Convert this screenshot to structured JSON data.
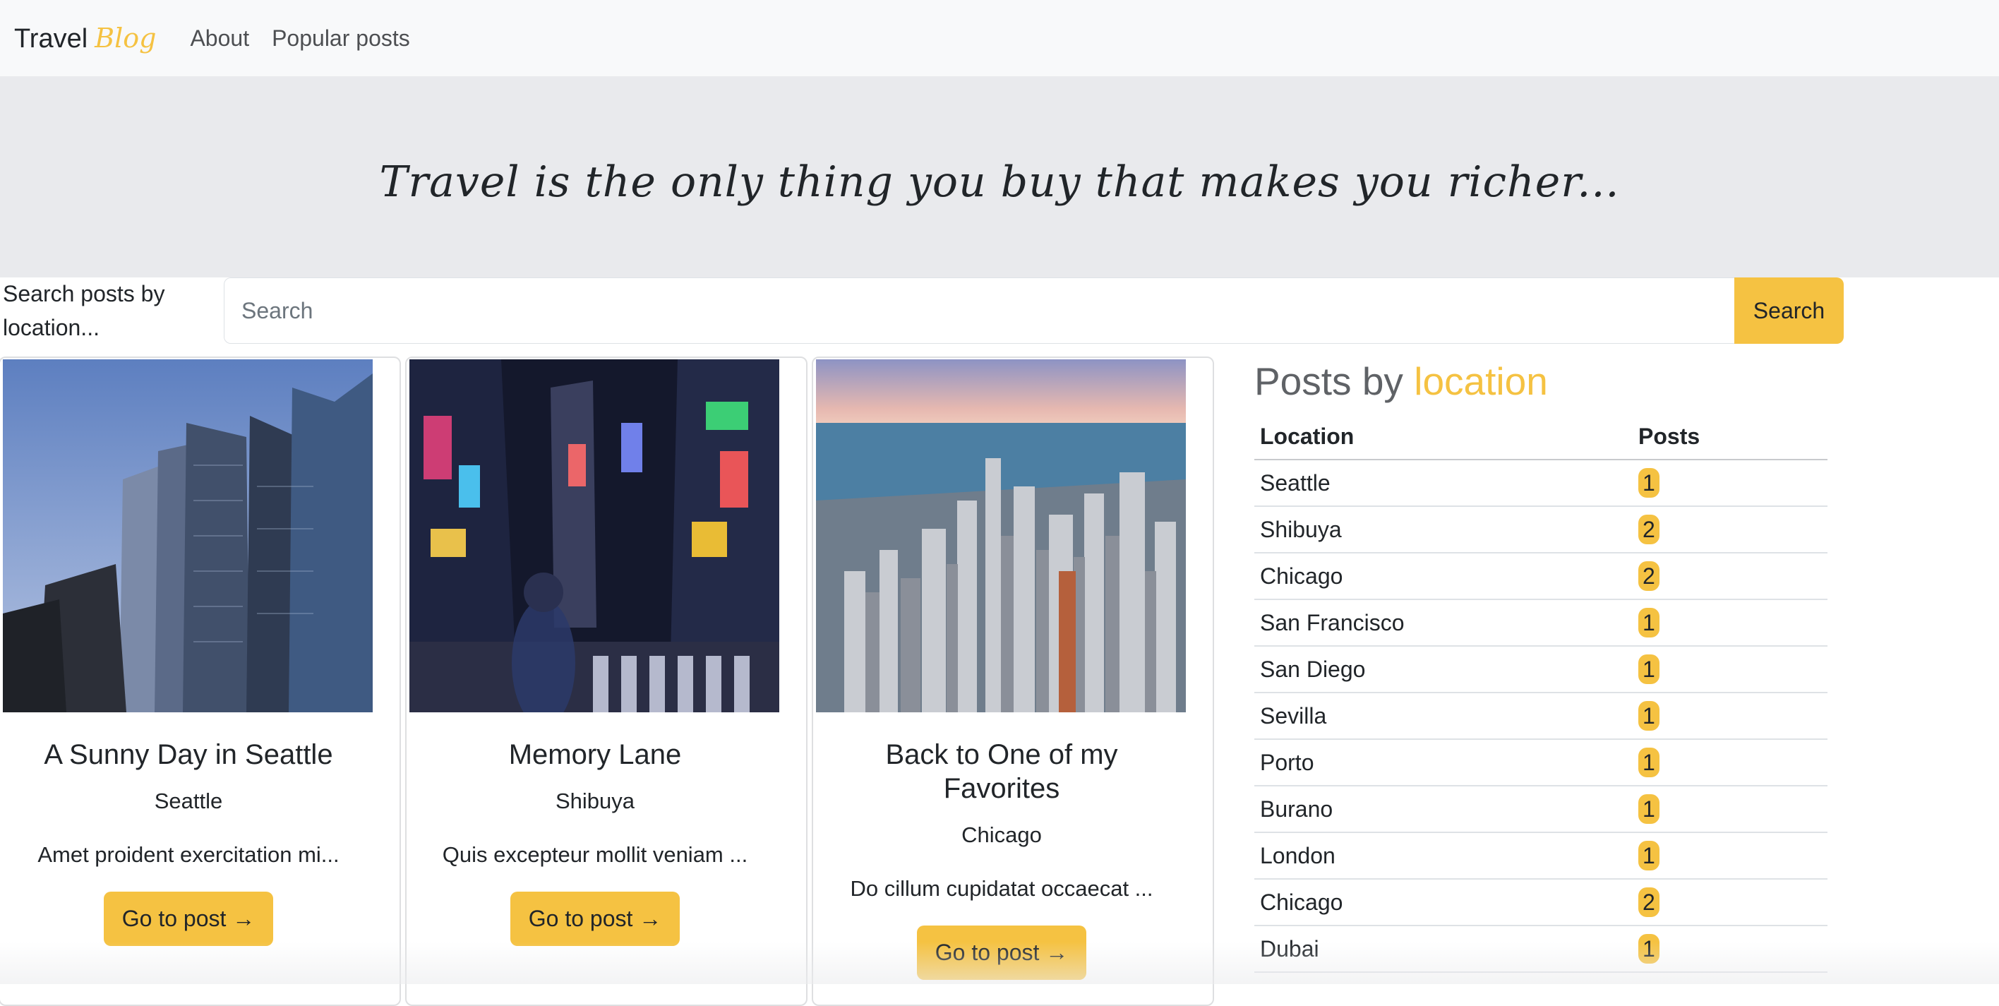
{
  "navbar": {
    "brand_main": "Travel",
    "brand_accent": "Blog",
    "links": [
      "About",
      "Popular posts"
    ]
  },
  "hero": {
    "quote": "Travel is the only thing you buy that makes you richer..."
  },
  "search": {
    "label": "Search posts by location...",
    "placeholder": "Search",
    "button": "Search"
  },
  "cards": [
    {
      "title": "A Sunny Day in Seattle",
      "location": "Seattle",
      "excerpt": "Amet proident exercitation mi...",
      "button": "Go to post →",
      "image": "seattle-skyscrapers-photo"
    },
    {
      "title": "Memory Lane",
      "location": "Shibuya",
      "excerpt": "Quis excepteur mollit veniam ...",
      "button": "Go to post →",
      "image": "shibuya-night-street-photo"
    },
    {
      "title": "Back to One of my Favorites",
      "location": "Chicago",
      "excerpt": "Do cillum cupidatat occaecat ...",
      "button": "Go to post →",
      "image": "chicago-aerial-skyline-photo"
    }
  ],
  "sidebar": {
    "title_prefix": "Posts by",
    "title_accent": "location",
    "headers": [
      "Location",
      "Posts"
    ],
    "rows": [
      {
        "location": "Seattle",
        "posts": "1"
      },
      {
        "location": "Shibuya",
        "posts": "2"
      },
      {
        "location": "Chicago",
        "posts": "2"
      },
      {
        "location": "San Francisco",
        "posts": "1"
      },
      {
        "location": "San Diego",
        "posts": "1"
      },
      {
        "location": "Sevilla",
        "posts": "1"
      },
      {
        "location": "Porto",
        "posts": "1"
      },
      {
        "location": "Burano",
        "posts": "1"
      },
      {
        "location": "London",
        "posts": "1"
      },
      {
        "location": "Chicago",
        "posts": "2"
      },
      {
        "location": "Dubai",
        "posts": "1"
      }
    ]
  },
  "colors": {
    "accent": "#f5c242",
    "navbar_bg": "#f8f9fa",
    "hero_bg": "#e9eaed"
  }
}
